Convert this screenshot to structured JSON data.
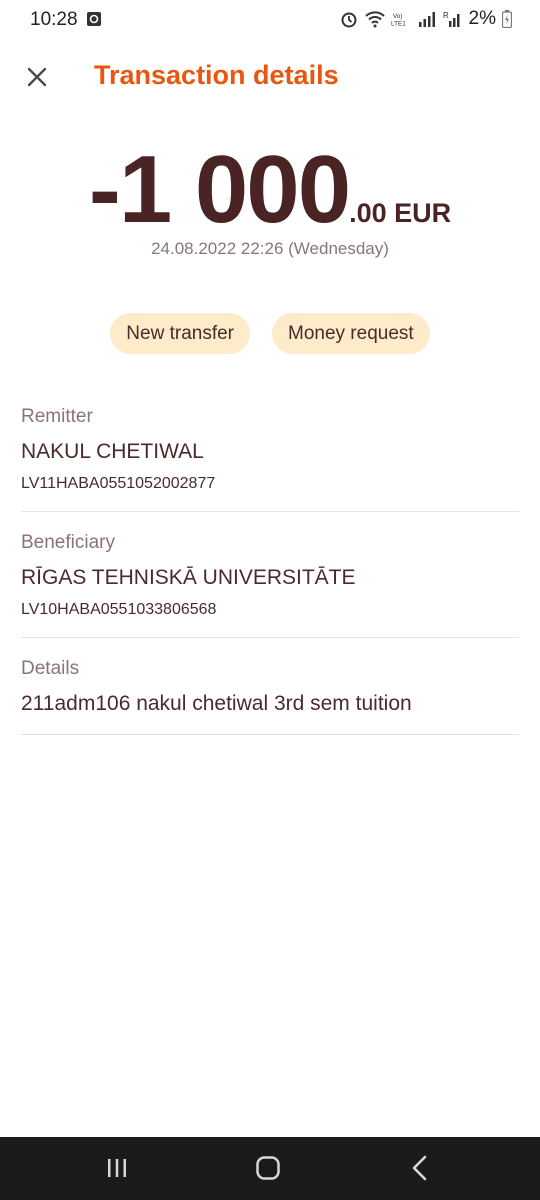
{
  "status": {
    "time": "10:28",
    "battery": "2%",
    "icons": [
      "notification-icon",
      "alarm-icon",
      "wifi-icon",
      "volte-icon",
      "signal-icon",
      "signal-roaming-icon",
      "battery-icon"
    ]
  },
  "header": {
    "title": "Transaction details",
    "close_icon": "close-icon"
  },
  "transaction": {
    "amount_main": "-1 000",
    "amount_fraction": ".00 EUR",
    "datetime": "24.08.2022 22:26 (Wednesday)"
  },
  "actions": {
    "new_transfer": "New transfer",
    "money_request": "Money request"
  },
  "remitter": {
    "label": "Remitter",
    "name": "NAKUL CHETIWAL",
    "account": "LV11HABA0551052002877"
  },
  "beneficiary": {
    "label": "Beneficiary",
    "name": "RĪGAS TEHNISKĀ UNIVERSITĀTE",
    "account": "LV10HABA0551033806568"
  },
  "details": {
    "label": "Details",
    "text": "211adm106 nakul chetiwal 3rd sem tuition"
  },
  "colors": {
    "accent": "#e8570f",
    "primary_text": "#4a2b2b",
    "secondary_text": "#8a7575",
    "chip_bg": "#fdebc9",
    "nav_bg": "#1b1b1b"
  }
}
